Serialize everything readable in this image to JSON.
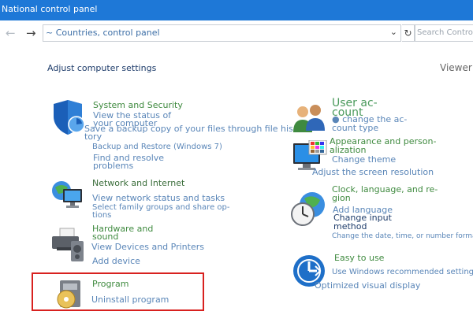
{
  "window": {
    "title": "National control panel"
  },
  "nav": {
    "back_icon": "back-arrow-icon",
    "forward_icon": "forward-arrow-icon",
    "address": "~ Countries, control panel",
    "dropdown_icon": "chevron-down-icon",
    "refresh_icon": "refresh-icon",
    "search_placeholder": "Search Control"
  },
  "page": {
    "heading": "Adjust computer settings",
    "view_label": "Viewer"
  },
  "left": {
    "system": {
      "icon": "shield-icon",
      "title": "System and Security",
      "links": [
        "View the status of",
        "your computer",
        "Save a backup copy of your files through file his-",
        "tory",
        "Backup and Restore (Windows 7)",
        "Find and resolve",
        "problems"
      ]
    },
    "network": {
      "icon": "globe-network-icon",
      "title": "Network and Internet",
      "links": [
        "View network status and tasks",
        "Select family groups and share op-",
        "tions"
      ]
    },
    "hardware": {
      "icon": "printer-icon",
      "title": [
        "Hardware and",
        "sound"
      ],
      "links": [
        "View Devices and Printers",
        "Add device"
      ]
    },
    "program": {
      "icon": "program-disc-icon",
      "title": "Program",
      "links": [
        "Uninstall program"
      ]
    }
  },
  "right": {
    "accounts": {
      "icon": "users-icon",
      "title": [
        "User ac-",
        "count"
      ],
      "links": [
        "● change the ac-",
        "count type"
      ]
    },
    "appearance": {
      "icon": "monitor-icon",
      "title": [
        "Appearance and person-",
        "alization"
      ],
      "links": [
        "Change theme",
        "Adjust the screen resolution"
      ]
    },
    "clock": {
      "icon": "clock-globe-icon",
      "title": [
        "Clock, language, and re-",
        "gion"
      ],
      "links": [
        "Add language",
        "Change input",
        "method",
        "Change the date, time, or number format"
      ]
    },
    "ease": {
      "icon": "ease-of-access-icon",
      "title": "Easy to use",
      "links": [
        "Use Windows recommended settings",
        "Optimized visual display"
      ]
    }
  },
  "colors": {
    "titlebar": "#1e78d7",
    "highlight": "#d8211f",
    "category": "#3f8a3f",
    "link": "#5a86b8"
  }
}
